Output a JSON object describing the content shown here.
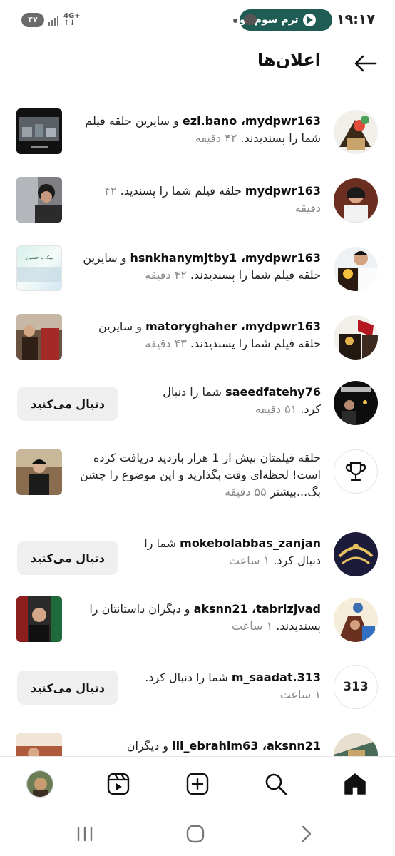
{
  "status_bar": {
    "time": "۱۹:۱۷",
    "media_pill": "ترم سوم دو",
    "battery": "۴۷",
    "network_top": "4G+"
  },
  "header": {
    "title": "اعلان‌ها"
  },
  "notifications": [
    {
      "users": "ezi.bano ،mydpwr163",
      "text": " و سایرین حلقه فیلم شما را پسندیدند.",
      "time": "۴۲ دقیقه"
    },
    {
      "users": "mydpwr163",
      "text": " حلقه فیلم شما را پسندید.",
      "time": "۴۲ دقیقه"
    },
    {
      "users": "hsnkhanymjtby1 ،mydpwr163",
      "text": " و سایرین حلقه فیلم شما را پسندیدند.",
      "time": "۴۲ دقیقه"
    },
    {
      "users": "matoryghaher ،mydpwr163",
      "text": " و سایرین حلقه فیلم شما را پسندیدند.",
      "time": "۴۳ دقیقه"
    },
    {
      "users": "saeedfatehy76",
      "text": " شما را دنبال کرد.",
      "time": "۵۱ دقیقه",
      "button": "دنبال می‌کنید"
    },
    {
      "users": "",
      "text": "حلقه فیلمتان بیش از 1 هزار بازدید دریافت کرده است! لحظه‌ای وقت بگذارید و این موضوع را جشن بگ...بیشتر",
      "time": "۵۵ دقیقه"
    },
    {
      "users": "mokebolabbas_zanjan",
      "text": " شما را دنبال کرد.",
      "time": "۱ ساعت",
      "button": "دنبال می‌کنید"
    },
    {
      "users": "aksnn21 ،tabrizjvad",
      "text": " و دیگران داستانتان را پسندیدند.",
      "time": "۱ ساعت"
    },
    {
      "users": "m_saadat.313",
      "text": " شما را دنبال کرد.",
      "time": "۱ ساعت",
      "button": "دنبال می‌کنید",
      "avatar_text": "313"
    },
    {
      "users": "lil_ebrahim63 ،aksnn21",
      "text": " و دیگران",
      "time": ""
    }
  ],
  "thumb_captions": {
    "row3": "لبیک یا حسین"
  },
  "icons": {
    "back": "arrow-left-icon",
    "trophy": "trophy-icon",
    "nav": [
      "profile-avatar",
      "reels-icon",
      "create-icon",
      "search-icon",
      "home-icon"
    ],
    "system": [
      "recent-apps-icon",
      "home-circle-icon",
      "back-chevron-icon"
    ]
  },
  "colors": {
    "media_pill": "#1f5c53",
    "button_bg": "#efefef",
    "muted_text": "#8a8a8a"
  }
}
